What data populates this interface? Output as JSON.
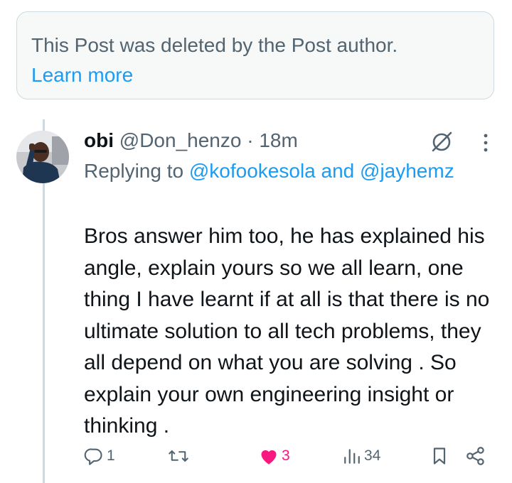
{
  "deleted_notice": {
    "text": "This Post was deleted by the Post author.",
    "link": "Learn more"
  },
  "post": {
    "author_name": "obi",
    "author_handle": "@Don_henzo",
    "separator": "·",
    "time": "18m",
    "replying_prefix": "Replying to",
    "mention_1": "@kofookesola",
    "mention_and": "and",
    "mention_2": "@jayhemz",
    "body": "Bros answer him too, he has explained his angle, explain yours so we all learn, one thing I have learnt if at all is that there is no ultimate solution to all tech problems, they all depend on what you are solving . So explain your own engineering insight or thinking ."
  },
  "actions": {
    "replies": "1",
    "reposts": "",
    "likes": "3",
    "views": "34"
  },
  "icons": [
    "reply-icon",
    "repost-icon",
    "like-icon",
    "views-icon",
    "bookmark-icon",
    "share-icon",
    "grok-icon",
    "more-icon"
  ],
  "colors": {
    "accent": "#1d9bf0",
    "secondary_text": "#536471",
    "like": "#f91880",
    "border": "#cfd9de"
  }
}
